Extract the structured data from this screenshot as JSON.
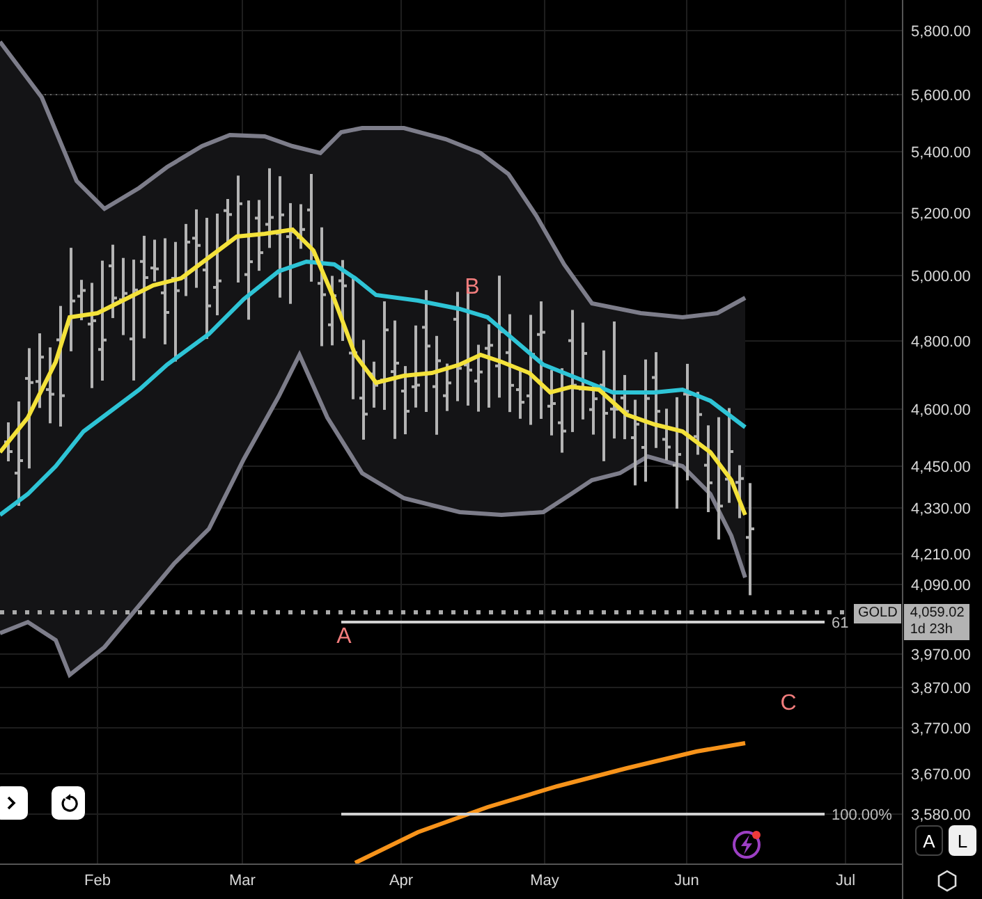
{
  "price_axis": {
    "labels": [
      "5,800.00",
      "5,600.00",
      "5,400.00",
      "5,200.00",
      "5,000.00",
      "4,800.00",
      "4,600.00",
      "4,450.00",
      "4,330.00",
      "4,210.00",
      "4,090.00",
      "3,970.00",
      "3,870.00",
      "3,770.00",
      "3,670.00",
      "3,580.00"
    ]
  },
  "time_axis": {
    "labels": [
      "Feb",
      "Mar",
      "Apr",
      "May",
      "Jun",
      "Jul"
    ]
  },
  "chart_markers": [
    {
      "label": "A"
    },
    {
      "label": "B"
    },
    {
      "label": "C"
    }
  ],
  "fib_levels": [
    {
      "label": "61"
    },
    {
      "label": "100.00%"
    }
  ],
  "price_tag": {
    "symbol": "GOLD",
    "price": "4,059.02",
    "countdown": "1d 23h"
  },
  "scale_buttons": [
    {
      "label": "A",
      "selected": false
    },
    {
      "label": "L",
      "selected": true
    }
  ]
}
